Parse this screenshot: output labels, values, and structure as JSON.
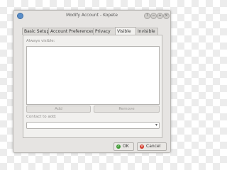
{
  "window": {
    "title": "Modify Account - Kopete"
  },
  "titlebar_buttons": [
    "?",
    "−",
    "+",
    "×"
  ],
  "tabs": [
    {
      "label": "Basic Setup",
      "active": false
    },
    {
      "label": "Account Preferences",
      "active": false
    },
    {
      "label": "Privacy",
      "active": false
    },
    {
      "label": "Visible",
      "active": true
    },
    {
      "label": "Invisible",
      "active": false
    }
  ],
  "visible_tab": {
    "always_visible_label": "Always visible:",
    "add_button": "Add",
    "remove_button": "Remove",
    "contact_to_add_label": "Contact to add:",
    "contact_to_add_value": ""
  },
  "dialog_buttons": {
    "ok": "OK",
    "cancel": "Cancel"
  },
  "colors": {
    "ok_icon": "#3f9c35",
    "cancel_icon": "#d23a2a",
    "app_icon": "#5a8ec9"
  }
}
